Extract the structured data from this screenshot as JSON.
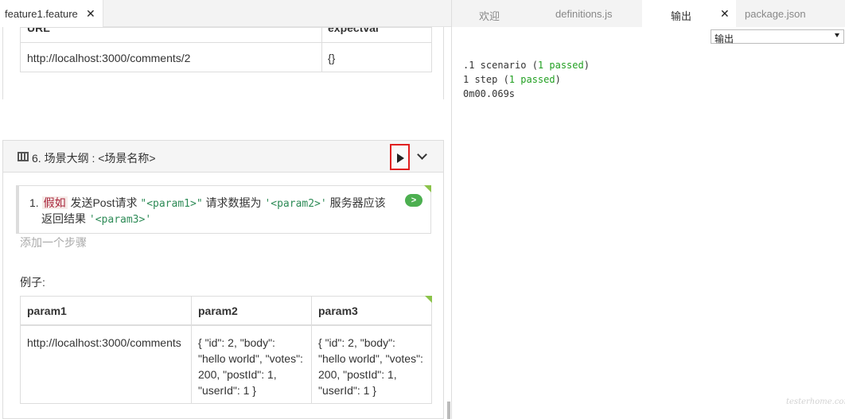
{
  "left_tab": {
    "label": "feature1.feature"
  },
  "top_table": {
    "headers": [
      "URL",
      "expectval"
    ],
    "row": [
      "http://localhost:3000/comments/2",
      "{}"
    ]
  },
  "scenario": {
    "title": "6. 场景大纲 : <场景名称>",
    "step": {
      "number": "1.",
      "keyword": "假如",
      "t1": "发送Post请求",
      "p1": "\"<param1>\"",
      "t2": "请求数据为",
      "p2": "'<param2>'",
      "t3": "服务器应该",
      "t4": "返回结果",
      "p3": "'<param3>'",
      "run_label": ">"
    },
    "add_step": "添加一个步骤",
    "examples_label": "例子:",
    "examples": {
      "headers": [
        "param1",
        "param2",
        "param3"
      ],
      "row": [
        [
          "http://localhost:3000/comments"
        ],
        [
          "{ \"id\": 2, \"body\":",
          "\"hello world\", \"votes\":",
          "200, \"postId\": 1,",
          "\"userId\": 1 }"
        ],
        [
          "{ \"id\": 2, \"body\":",
          "\"hello world\", \"votes\":",
          "200, \"postId\": 1,",
          "\"userId\": 1 }"
        ]
      ]
    }
  },
  "right_tabs": [
    "欢迎",
    "definitions.js",
    "输出",
    "package.json"
  ],
  "output_select": {
    "value": "输出"
  },
  "console": {
    "line1_prefix": ".1 scenario (",
    "line1_pass": "1 passed",
    "line1_suffix": ")",
    "line2_prefix": "1 step (",
    "line2_pass": "1 passed",
    "line2_suffix": ")",
    "line3": "0m00.069s"
  },
  "watermark": "testerhome.com",
  "colors": {
    "pass": "#22a022",
    "run_border": "#e02020",
    "step_run": "#4caf50",
    "keyword": "#a8243a",
    "param": "#2e8b57"
  }
}
